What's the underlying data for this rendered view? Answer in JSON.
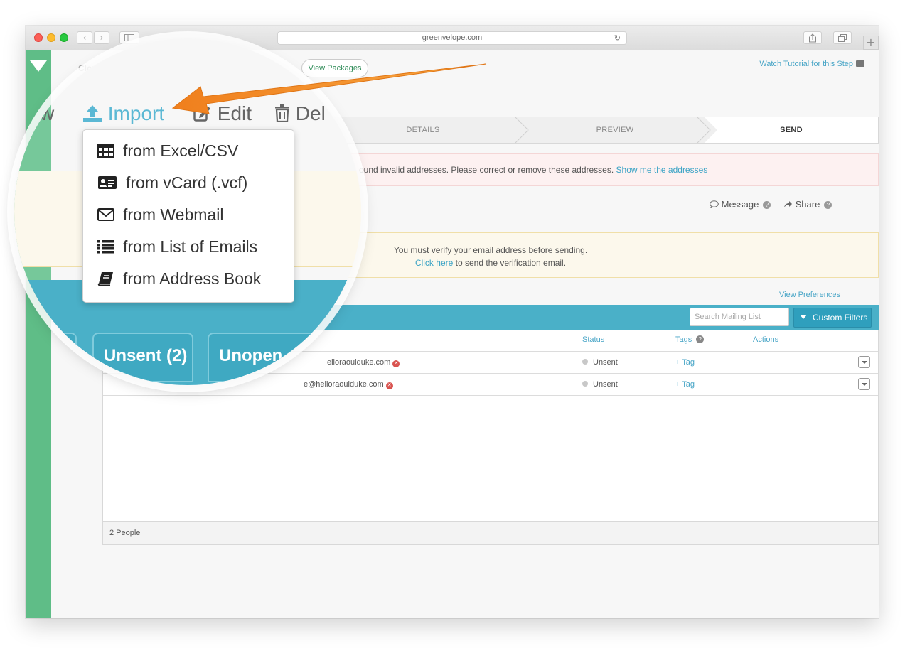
{
  "browser": {
    "url": "greenvelope.com",
    "reload_icon": "reload-icon",
    "share_icon": "share-icon",
    "tabs_icon": "tabs-icon",
    "new_tab_icon": "plus-icon"
  },
  "header": {
    "project_name": "Cloud",
    "view_packages": "View Packages",
    "tutorial_link": "Watch Tutorial for this Step"
  },
  "steps": [
    "DETAILS",
    "PREVIEW",
    "SEND"
  ],
  "alert_invalid": {
    "text": "ound invalid addresses. Please correct or remove these addresses.",
    "link": "Show me the addresses"
  },
  "actions": {
    "message": "Message",
    "share": "Share"
  },
  "alert_verify": {
    "line1": "You must verify your email address before sending.",
    "link": "Click here",
    "line2": "to send the verification email."
  },
  "view_preferences": "View Preferences",
  "search": {
    "placeholder": "Search Mailing List"
  },
  "custom_filters": "Custom Filters",
  "table": {
    "headers": [
      "Status",
      "Tags",
      "Actions"
    ],
    "rows": [
      {
        "email": "elloraoulduke.com",
        "status": "Unsent",
        "tag": "+ Tag"
      },
      {
        "email": "e@helloraoulduke.com",
        "status": "Unsent",
        "tag": "+ Tag"
      }
    ]
  },
  "footer": {
    "count": "2 People"
  },
  "magnifier": {
    "toolbar": {
      "view": "w",
      "import": "Import",
      "edit": "Edit",
      "delete": "Del"
    },
    "menu": [
      {
        "label": "from Excel/CSV",
        "icon": "table-icon"
      },
      {
        "label": "from vCard (.vcf)",
        "icon": "vcard-icon"
      },
      {
        "label": "from Webmail",
        "icon": "envelope-icon"
      },
      {
        "label": "from List of Emails",
        "icon": "list-icon"
      },
      {
        "label": "from Address Book",
        "icon": "book-icon"
      }
    ],
    "tabs": {
      "unsent": "Unsent (2)",
      "unopened": "Unopen"
    }
  },
  "colors": {
    "sidebar": "#5fbd87",
    "teal": "#4ab0c8",
    "link": "#4aa6c7",
    "arrow": "#f5922e"
  }
}
